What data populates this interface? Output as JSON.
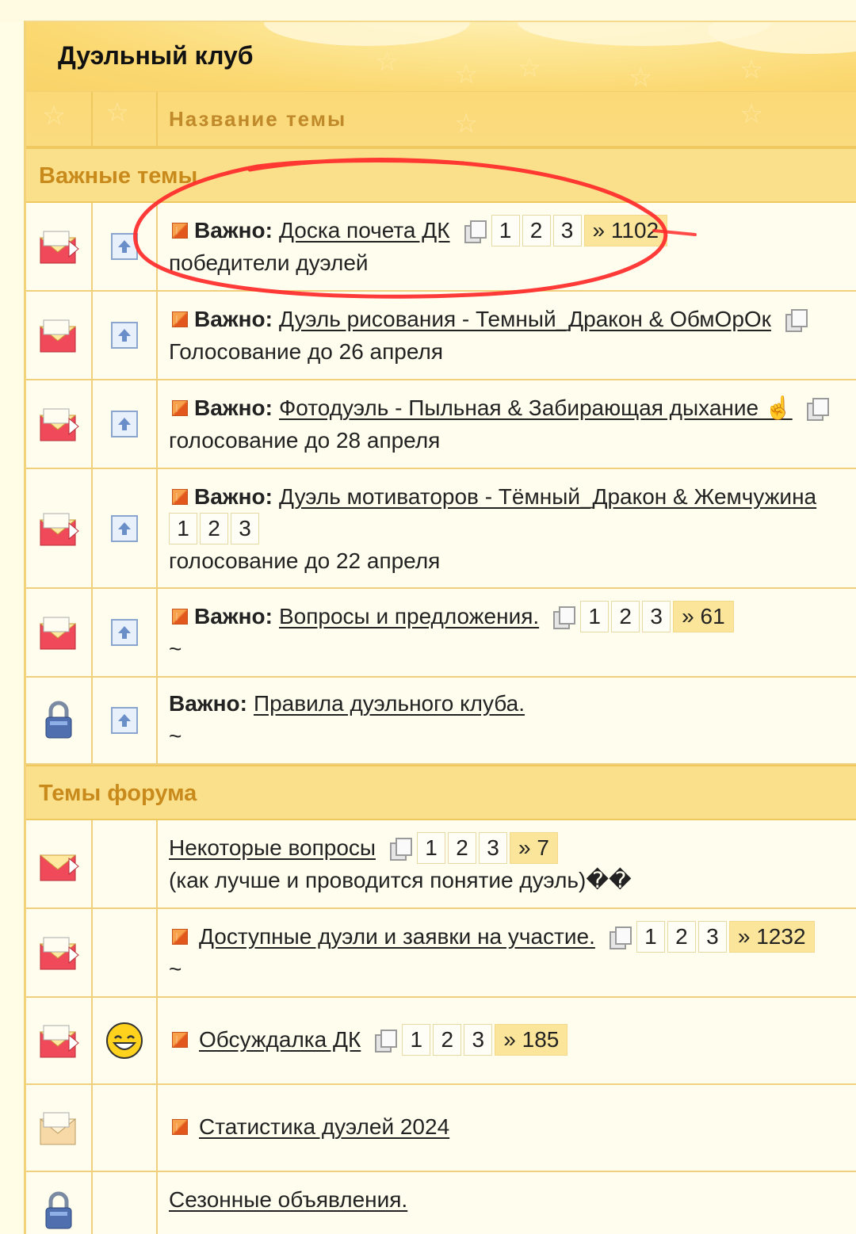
{
  "forum": {
    "title": "Дуэльный клуб",
    "column_header": "Название темы"
  },
  "sections": {
    "important": "Важные темы",
    "forum_topics": "Темы форума"
  },
  "important_prefix": "Важно:",
  "important_topics": [
    {
      "title": "Доска почета ДК",
      "pages": [
        "1",
        "2",
        "3",
        "» 1102"
      ],
      "subtitle": "победители дуэлей",
      "icon": "hot-envelope-icon"
    },
    {
      "title": "Дуэль рисования - Темный_Дракон & ОбмОрОк",
      "pages": [],
      "subtitle": "Голосование до 26 апреля",
      "icon": "hot-envelope-icon"
    },
    {
      "title": "Фотодуэль - Пыльная & Забирающая дыхание ☝️",
      "pages": [],
      "subtitle": "голосование до 28 апреля",
      "icon": "hot-envelope-icon"
    },
    {
      "title": "Дуэль мотиваторов - Тёмный_Дракон & Жемчужина",
      "pages": [
        "1",
        "2",
        "3"
      ],
      "subtitle": "голосование до 22 апреля",
      "icon": "hot-envelope-icon"
    },
    {
      "title": "Вопросы и предложения.",
      "pages": [
        "1",
        "2",
        "3",
        "» 61"
      ],
      "subtitle": "~",
      "icon": "hot-envelope-icon"
    },
    {
      "title": "Правила дуэльного клуба.",
      "pages": [],
      "subtitle": "~",
      "icon": "lock-icon"
    }
  ],
  "forum_topics": [
    {
      "title": "Некоторые вопросы",
      "pages": [
        "1",
        "2",
        "3",
        "» 7"
      ],
      "subtitle": "(как лучше и проводится понятие дуэль)��"
    },
    {
      "title": "Доступные дуэли и заявки на участие.",
      "pages": [
        "1",
        "2",
        "3",
        "» 1232"
      ],
      "subtitle": "~"
    },
    {
      "title": "Обсуждалка ДК",
      "pages": [
        "1",
        "2",
        "3",
        "» 185"
      ],
      "subtitle": ""
    },
    {
      "title": "Статистика дуэлей 2024",
      "pages": [],
      "subtitle": ""
    },
    {
      "title": "Сезонные объявления.",
      "pages": [],
      "subtitle": "..."
    }
  ],
  "colors": {
    "header_bg": "#fbd977",
    "section_text": "#c98a1c",
    "highlight_circle": "#ff2a2a"
  }
}
